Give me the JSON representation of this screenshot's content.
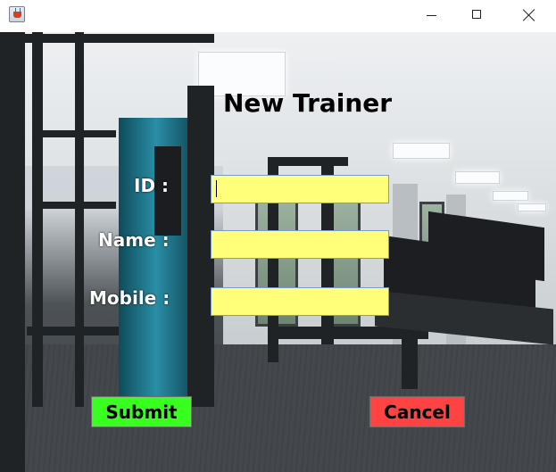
{
  "window": {
    "title": "",
    "controls": [
      "minimize-icon",
      "maximize-icon",
      "close-icon"
    ]
  },
  "form": {
    "title": "New Trainer",
    "id_label": "ID :",
    "id_value": "",
    "name_label": "Name :",
    "name_value": "",
    "mobile_label": "Mobile :",
    "mobile_value": "",
    "field_color": "#ffff7a",
    "submit_label": "Submit",
    "submit_color": "#38ff1f",
    "cancel_label": "Cancel",
    "cancel_color": "#ff4343"
  },
  "background": {
    "description_icon": "gym-background-image"
  }
}
